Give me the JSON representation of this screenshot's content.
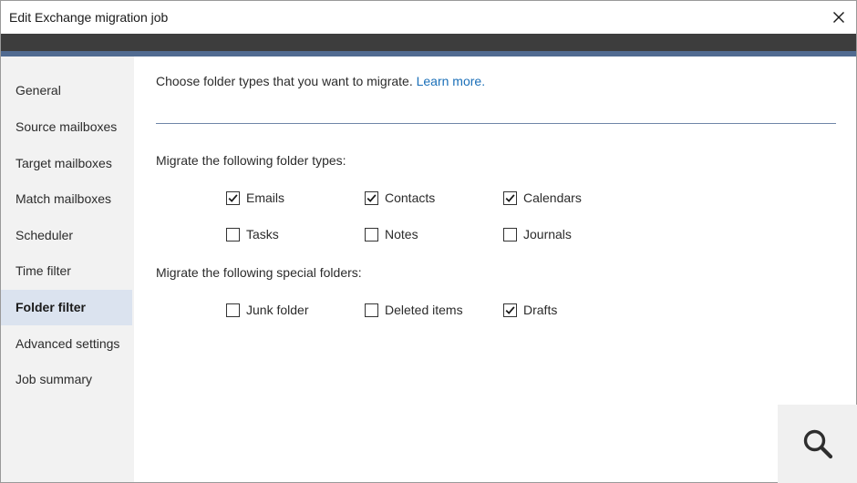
{
  "window": {
    "title": "Edit Exchange migration job"
  },
  "sidebar": {
    "items": [
      {
        "label": "General",
        "active": false
      },
      {
        "label": "Source mailboxes",
        "active": false
      },
      {
        "label": "Target mailboxes",
        "active": false
      },
      {
        "label": "Match mailboxes",
        "active": false
      },
      {
        "label": "Scheduler",
        "active": false
      },
      {
        "label": "Time filter",
        "active": false
      },
      {
        "label": "Folder filter",
        "active": true
      },
      {
        "label": "Advanced settings",
        "active": false
      },
      {
        "label": "Job summary",
        "active": false
      }
    ]
  },
  "main": {
    "intro_text": "Choose folder types that you want to migrate.",
    "learn_more_link": "Learn more.",
    "folder_types": {
      "heading": "Migrate the following folder types:",
      "options": [
        {
          "label": "Emails",
          "checked": true
        },
        {
          "label": "Contacts",
          "checked": true
        },
        {
          "label": "Calendars",
          "checked": true
        },
        {
          "label": "Tasks",
          "checked": false
        },
        {
          "label": "Notes",
          "checked": false
        },
        {
          "label": "Journals",
          "checked": false
        }
      ]
    },
    "special_folders": {
      "heading": "Migrate the following special folders:",
      "options": [
        {
          "label": "Junk folder",
          "checked": false
        },
        {
          "label": "Deleted items",
          "checked": false
        },
        {
          "label": "Drafts",
          "checked": true
        }
      ]
    }
  },
  "icons": {
    "close": "close-icon",
    "search": "search-icon",
    "check": "checkmark-icon"
  },
  "colors": {
    "accent_bar": "#516b91",
    "header_bar": "#3d3d3d",
    "link": "#1a6fb8",
    "active_nav": "#dbe3ef"
  }
}
